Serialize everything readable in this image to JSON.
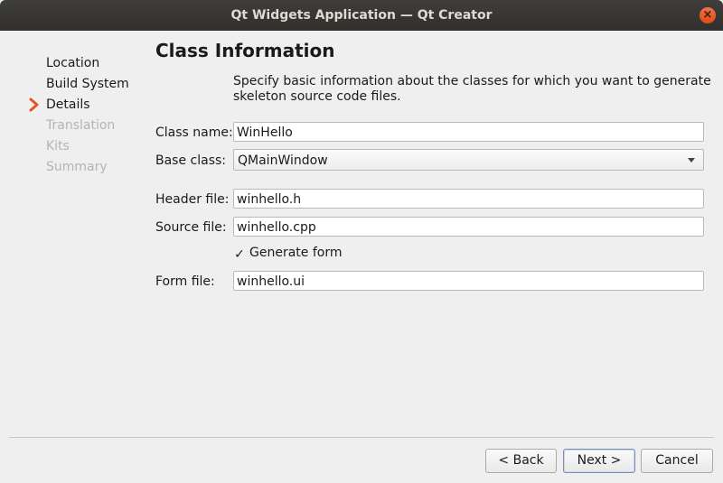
{
  "window": {
    "title": "Qt Widgets Application — Qt Creator",
    "close_glyph": "×"
  },
  "steps": [
    {
      "label": "Location",
      "state": "done"
    },
    {
      "label": "Build System",
      "state": "done"
    },
    {
      "label": "Details",
      "state": "current"
    },
    {
      "label": "Translation",
      "state": "pending"
    },
    {
      "label": "Kits",
      "state": "pending"
    },
    {
      "label": "Summary",
      "state": "pending"
    }
  ],
  "page": {
    "title": "Class Information",
    "description": "Specify basic information about the classes for which you want to generate skeleton source code files."
  },
  "form": {
    "class_name_label": "Class name:",
    "class_name_value": "WinHello",
    "base_class_label": "Base class:",
    "base_class_value": "QMainWindow",
    "header_file_label": "Header file:",
    "header_file_value": "winhello.h",
    "source_file_label": "Source file:",
    "source_file_value": "winhello.cpp",
    "generate_form_label": "Generate form",
    "generate_form_checked": true,
    "check_glyph": "✓",
    "form_file_label": "Form file:",
    "form_file_value": "winhello.ui"
  },
  "buttons": {
    "back": "< Back",
    "next": "Next >",
    "cancel": "Cancel"
  },
  "colors": {
    "arrow_accent": "#e0572a",
    "titlebar": "#353431",
    "close": "#e95420"
  }
}
